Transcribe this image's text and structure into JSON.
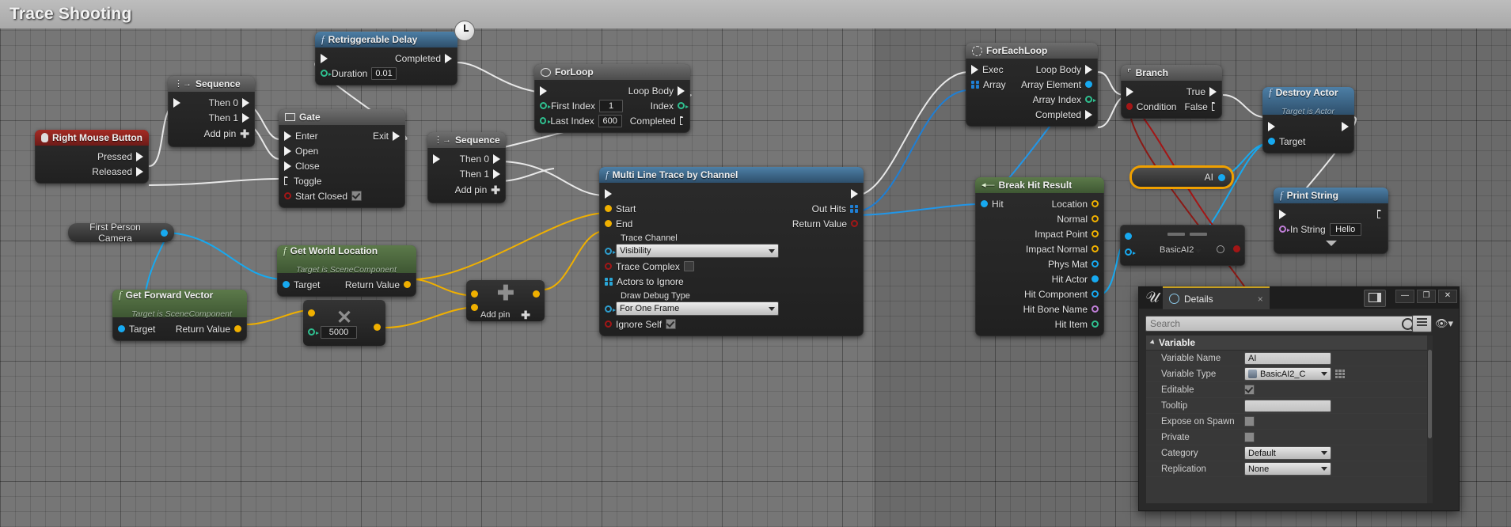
{
  "window": {
    "title": "Trace Shooting"
  },
  "nodes": {
    "right_mouse_button": {
      "title": "Right Mouse Button",
      "icon": "mouse-icon",
      "outputs": [
        "Pressed",
        "Released"
      ]
    },
    "sequence_1": {
      "title": "Sequence",
      "icon": "sequence-icon",
      "outputs": [
        "Then 0",
        "Then 1"
      ],
      "add_pin": "Add pin"
    },
    "gate": {
      "title": "Gate",
      "icon": "gate-icon",
      "inputs": [
        "Enter",
        "Open",
        "Close",
        "Toggle"
      ],
      "outputs": [
        "Exit"
      ],
      "start_closed_label": "Start Closed",
      "start_closed_value": true
    },
    "retriggerable_delay": {
      "title": "Retriggerable Delay",
      "icon": "function-icon",
      "badge": "clock-icon",
      "outputs": [
        "Completed"
      ],
      "duration_label": "Duration",
      "duration_value": "0.01"
    },
    "for_loop": {
      "title": "ForLoop",
      "icon": "loop-icon",
      "inputs": [
        {
          "label": "First Index",
          "value": "1"
        },
        {
          "label": "Last Index",
          "value": "600"
        }
      ],
      "outputs": [
        "Loop Body",
        "Index",
        "Completed"
      ]
    },
    "sequence_2": {
      "title": "Sequence",
      "icon": "sequence-icon",
      "outputs": [
        "Then 0",
        "Then 1"
      ],
      "add_pin": "Add pin"
    },
    "first_person_camera": {
      "title": "First Person Camera"
    },
    "get_forward_vector": {
      "title": "Get Forward Vector",
      "subtitle": "Target is SceneComponent",
      "icon": "function-icon",
      "inputs": [
        "Target"
      ],
      "outputs": [
        "Return Value"
      ]
    },
    "get_world_location": {
      "title": "Get World Location",
      "subtitle": "Target is SceneComponent",
      "icon": "function-icon",
      "inputs": [
        "Target"
      ],
      "outputs": [
        "Return Value"
      ]
    },
    "multiply": {
      "glyph": "multiply-icon",
      "value": "5000"
    },
    "add": {
      "glyph": "plus-icon",
      "add_pin": "Add pin"
    },
    "multi_line_trace": {
      "title": "Multi Line Trace by Channel",
      "icon": "function-icon",
      "inputs": [
        "Start",
        "End"
      ],
      "outputs": [
        "Out Hits",
        "Return Value"
      ],
      "trace_channel_label": "Trace Channel",
      "trace_channel_value": "Visibility",
      "trace_complex_label": "Trace Complex",
      "trace_complex_value": false,
      "actors_to_ignore_label": "Actors to Ignore",
      "draw_debug_label": "Draw Debug Type",
      "draw_debug_value": "For One Frame",
      "ignore_self_label": "Ignore Self",
      "ignore_self_value": true
    },
    "for_each_loop": {
      "title": "ForEachLoop",
      "icon": "loop-icon",
      "inputs": [
        "Exec",
        "Array"
      ],
      "outputs": [
        "Loop Body",
        "Array Element",
        "Array Index",
        "Completed"
      ]
    },
    "break_hit_result": {
      "title": "Break Hit Result",
      "icon": "break-icon",
      "inputs": [
        "Hit"
      ],
      "outputs": [
        "Location",
        "Normal",
        "Impact Point",
        "Impact Normal",
        "Phys Mat",
        "Hit Actor",
        "Hit Component",
        "Hit Bone Name",
        "Hit Item"
      ]
    },
    "cast_node": {
      "title": "BasicAI2"
    },
    "branch": {
      "title": "Branch",
      "icon": "branch-icon",
      "inputs": [
        "Condition"
      ],
      "outputs": [
        "True",
        "False"
      ]
    },
    "ai_variable": {
      "title": "AI",
      "selected": true
    },
    "destroy_actor": {
      "title": "Destroy Actor",
      "subtitle": "Target is Actor",
      "icon": "function-icon",
      "inputs": [
        "Target"
      ]
    },
    "print_string": {
      "title": "Print String",
      "icon": "function-icon",
      "in_string_label": "In String",
      "in_string_value": "Hello",
      "expand": "expand-arrow-icon"
    }
  },
  "details_panel": {
    "tab_label": "Details",
    "tab_icon": "details-magnifier-icon",
    "close_icon": "close-icon",
    "layout_icon": "layout-icon",
    "minimize_label": "—",
    "maximize_label": "❐",
    "close_label": "✕",
    "search_placeholder": "Search",
    "search_icon": "search-icon",
    "grid_icon": "grid-view-icon",
    "eye_icon": "eye-icon",
    "category_label": "Variable",
    "properties": [
      {
        "name": "Variable Name",
        "type": "text",
        "value": "AI"
      },
      {
        "name": "Variable Type",
        "type": "combo",
        "value": "BasicAI2_C"
      },
      {
        "name": "Editable",
        "type": "checkbox",
        "value": true
      },
      {
        "name": "Tooltip",
        "type": "text",
        "value": ""
      },
      {
        "name": "Expose on Spawn",
        "type": "checkbox",
        "value": false
      },
      {
        "name": "Private",
        "type": "checkbox",
        "value": false
      },
      {
        "name": "Category",
        "type": "combo",
        "value": "Default"
      },
      {
        "name": "Replication",
        "type": "combo",
        "value": "None"
      }
    ]
  },
  "colors": {
    "exec_white": "#ffffff",
    "vector_yellow": "#f0b000",
    "float_green": "#2fbf8f",
    "bool_red": "#a31616",
    "object_blue": "#17a9f0",
    "name_purple": "#c07fd8",
    "array_blue": "#1f7fd4",
    "selection_orange": "#f0a000"
  }
}
